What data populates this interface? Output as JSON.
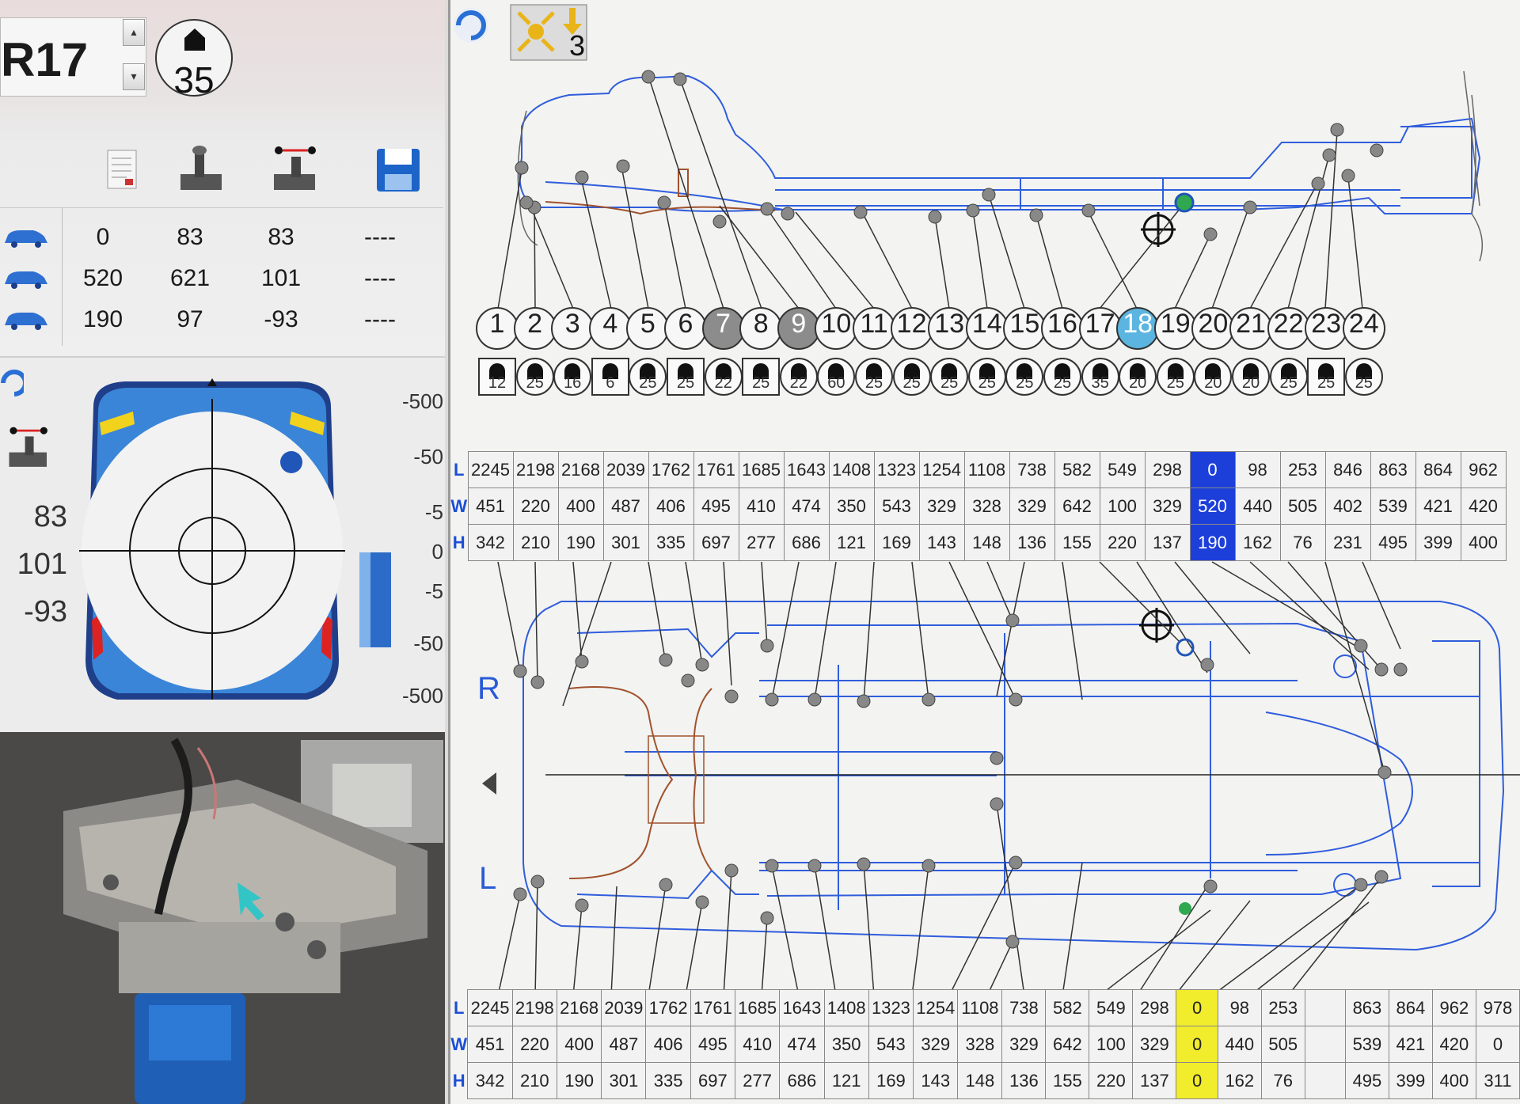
{
  "reference": {
    "code": "R17"
  },
  "hole": {
    "value": "35"
  },
  "readout_grid": {
    "rows": [
      {
        "icon": "car-side-icon",
        "values": [
          "0",
          "83",
          "83",
          "----"
        ]
      },
      {
        "icon": "car-width-icon",
        "values": [
          "520",
          "621",
          "101",
          "----"
        ]
      },
      {
        "icon": "car-height-icon",
        "values": [
          "190",
          "97",
          "-93",
          "----"
        ]
      }
    ]
  },
  "target": {
    "side_values": [
      "83",
      "101",
      "-93"
    ],
    "scale": [
      "-500",
      "-50",
      "-5",
      "0",
      "-5",
      "-50",
      "-500"
    ]
  },
  "toolbar": {
    "view_number": "3"
  },
  "points": [
    {
      "num": "1",
      "size": "12",
      "shape": "square"
    },
    {
      "num": "2",
      "size": "25",
      "shape": "round"
    },
    {
      "num": "3",
      "size": "16",
      "shape": "round"
    },
    {
      "num": "4",
      "size": "6",
      "shape": "square"
    },
    {
      "num": "5",
      "size": "25",
      "shape": "round"
    },
    {
      "num": "6",
      "size": "25",
      "shape": "square"
    },
    {
      "num": "7",
      "size": "22",
      "shape": "round",
      "state": "grey"
    },
    {
      "num": "8",
      "size": "25",
      "shape": "square"
    },
    {
      "num": "9",
      "size": "22",
      "shape": "round",
      "state": "grey"
    },
    {
      "num": "10",
      "size": "60",
      "shape": "round"
    },
    {
      "num": "11",
      "size": "25",
      "shape": "round"
    },
    {
      "num": "12",
      "size": "25",
      "shape": "round"
    },
    {
      "num": "13",
      "size": "25",
      "shape": "round"
    },
    {
      "num": "14",
      "size": "25",
      "shape": "round"
    },
    {
      "num": "15",
      "size": "25",
      "shape": "round"
    },
    {
      "num": "16",
      "size": "25",
      "shape": "round"
    },
    {
      "num": "17",
      "size": "35",
      "shape": "round"
    },
    {
      "num": "18",
      "size": "20",
      "shape": "round",
      "state": "blue"
    },
    {
      "num": "19",
      "size": "25",
      "shape": "round"
    },
    {
      "num": "20",
      "size": "20",
      "shape": "round"
    },
    {
      "num": "21",
      "size": "20",
      "shape": "round"
    },
    {
      "num": "22",
      "size": "25",
      "shape": "round"
    },
    {
      "num": "23",
      "size": "25",
      "shape": "square"
    },
    {
      "num": "24",
      "size": "25",
      "shape": "round"
    }
  ],
  "top_table": {
    "row_labels": [
      "L",
      "W",
      "H"
    ],
    "L": [
      "2245",
      "2198",
      "2168",
      "2039",
      "1762",
      "1761",
      "1685",
      "1643",
      "1408",
      "1323",
      "1254",
      "1108",
      "738",
      "582",
      "549",
      "298",
      "0",
      "98",
      "253",
      "846",
      "863",
      "864",
      "962"
    ],
    "W": [
      "451",
      "220",
      "400",
      "487",
      "406",
      "495",
      "410",
      "474",
      "350",
      "543",
      "329",
      "328",
      "329",
      "642",
      "100",
      "329",
      "520",
      "440",
      "505",
      "402",
      "539",
      "421",
      "420"
    ],
    "H": [
      "342",
      "210",
      "190",
      "301",
      "335",
      "697",
      "277",
      "686",
      "121",
      "169",
      "143",
      "148",
      "136",
      "155",
      "220",
      "137",
      "190",
      "162",
      "76",
      "231",
      "495",
      "399",
      "400"
    ],
    "highlight_col": 16
  },
  "bottom_table": {
    "row_labels": [
      "L",
      "W",
      "H"
    ],
    "L": [
      "2245",
      "2198",
      "2168",
      "2039",
      "1762",
      "1761",
      "1685",
      "1643",
      "1408",
      "1323",
      "1254",
      "1108",
      "738",
      "582",
      "549",
      "298",
      "0",
      "98",
      "253",
      "",
      "863",
      "864",
      "962",
      "978"
    ],
    "W": [
      "451",
      "220",
      "400",
      "487",
      "406",
      "495",
      "410",
      "474",
      "350",
      "543",
      "329",
      "328",
      "329",
      "642",
      "100",
      "329",
      "0",
      "440",
      "505",
      "",
      "539",
      "421",
      "420",
      "0"
    ],
    "H": [
      "342",
      "210",
      "190",
      "301",
      "335",
      "697",
      "277",
      "686",
      "121",
      "169",
      "143",
      "148",
      "136",
      "155",
      "220",
      "137",
      "0",
      "162",
      "76",
      "",
      "495",
      "399",
      "400",
      "311"
    ],
    "highlight_col": 16
  },
  "diagram_labels": {
    "right": "R",
    "left": "L"
  },
  "colors": {
    "selected_blue": "#1d3fd9",
    "point_blue": "#5bb5e0",
    "missing_yellow": "#f1ec2c",
    "frame_blue": "#2a5bd6"
  }
}
